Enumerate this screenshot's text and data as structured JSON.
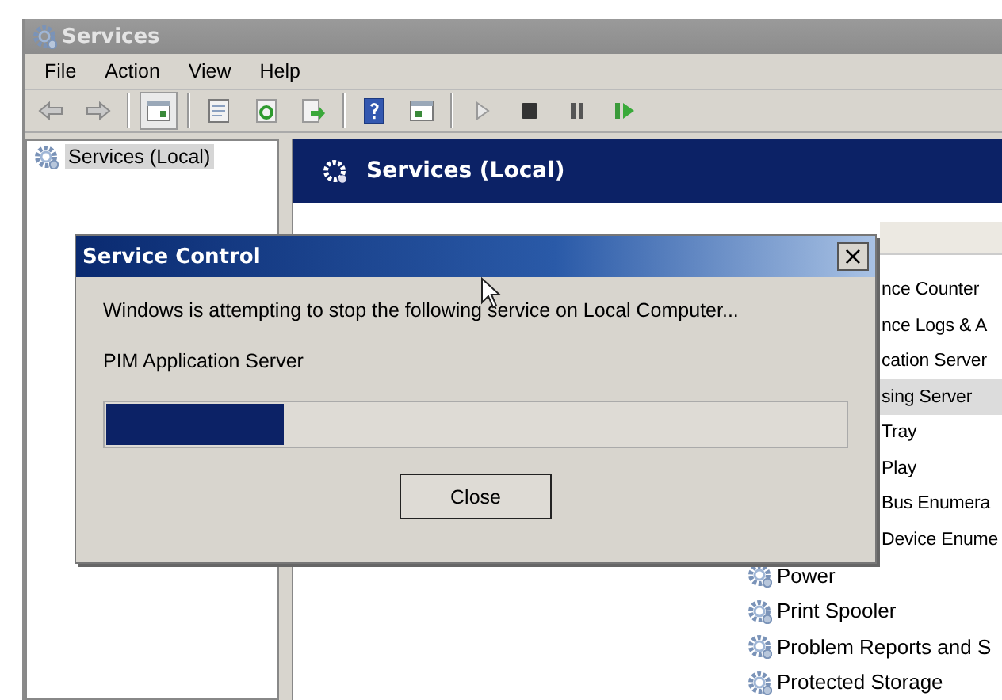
{
  "window": {
    "title": "Services"
  },
  "menu": [
    {
      "label": "File"
    },
    {
      "label": "Action"
    },
    {
      "label": "View"
    },
    {
      "label": "Help"
    }
  ],
  "toolbar": [
    {
      "kind": "back",
      "pressed": false
    },
    {
      "kind": "forward",
      "pressed": false
    },
    {
      "kind": "sep"
    },
    {
      "kind": "tree",
      "pressed": true
    },
    {
      "kind": "sep"
    },
    {
      "kind": "properties",
      "pressed": false
    },
    {
      "kind": "refresh",
      "pressed": false
    },
    {
      "kind": "export",
      "pressed": false
    },
    {
      "kind": "sep"
    },
    {
      "kind": "help",
      "pressed": false
    },
    {
      "kind": "pane",
      "pressed": false
    },
    {
      "kind": "sep"
    },
    {
      "kind": "play",
      "pressed": false
    },
    {
      "kind": "stop",
      "pressed": false
    },
    {
      "kind": "pause",
      "pressed": false
    },
    {
      "kind": "resume",
      "pressed": false
    }
  ],
  "tree": {
    "items": [
      {
        "label": "Services (Local)",
        "selected": true
      }
    ]
  },
  "pane_header": {
    "title": "Services (Local)"
  },
  "services": [
    {
      "name": "nce Counter",
      "kind": "covered",
      "selected": false
    },
    {
      "name": "nce Logs & A",
      "kind": "covered",
      "selected": false
    },
    {
      "name": "cation Server",
      "kind": "covered",
      "selected": false
    },
    {
      "name": "sing Server",
      "kind": "covered",
      "selected": true
    },
    {
      "name": "Tray",
      "kind": "covered",
      "selected": false
    },
    {
      "name": "Play",
      "kind": "covered",
      "selected": false
    },
    {
      "name": "Bus Enumera",
      "kind": "covered",
      "selected": false
    },
    {
      "name": "Device Enume",
      "kind": "covered",
      "selected": false
    },
    {
      "name": "Power",
      "kind": "full",
      "selected": false
    },
    {
      "name": "Print Spooler",
      "kind": "full",
      "selected": false
    },
    {
      "name": "Problem Reports and S",
      "kind": "full",
      "selected": false
    },
    {
      "name": "Protected Storage",
      "kind": "full",
      "selected": false
    }
  ],
  "dialog": {
    "title": "Service Control",
    "message": "Windows is attempting to stop the following service on Local Computer...",
    "service": "PIM Application Server",
    "progress": {
      "level": 0.24
    },
    "buttons": [
      {
        "label": "Close"
      }
    ],
    "close_glyph": "×"
  }
}
